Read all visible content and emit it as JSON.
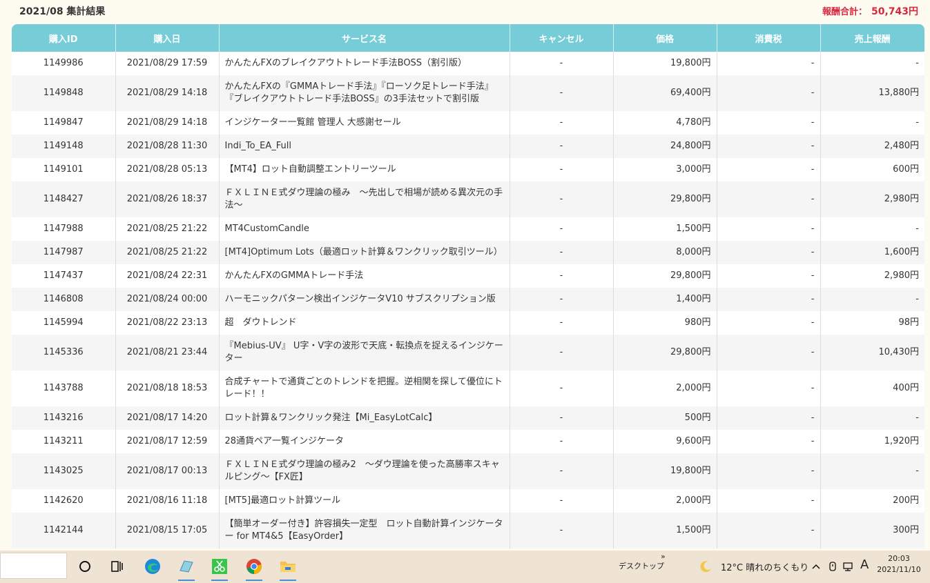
{
  "header": {
    "title": "2021/08 集計結果",
    "total_label": "報酬合計：",
    "total_value": "50,743円"
  },
  "table": {
    "columns": [
      "購入ID",
      "購入日",
      "サービス名",
      "キャンセル",
      "価格",
      "消費税",
      "売上報酬"
    ],
    "rows": [
      {
        "id": "1149986",
        "date": "2021/08/29 17:59",
        "service": "かんたんFXのブレイクアウトトレード手法BOSS（割引版）",
        "cancel": "-",
        "price": "19,800円",
        "tax": "-",
        "reward": "-"
      },
      {
        "id": "1149848",
        "date": "2021/08/29 14:18",
        "service": "かんたんFXの『GMMAトレード手法』『ローソク足トレード手法』『ブレイクアウトトレード手法BOSS』の3手法セットで割引版",
        "cancel": "-",
        "price": "69,400円",
        "tax": "-",
        "reward": "13,880円"
      },
      {
        "id": "1149847",
        "date": "2021/08/29 14:18",
        "service": "インジケーター一覧館 管理人 大感謝セール",
        "cancel": "-",
        "price": "4,780円",
        "tax": "-",
        "reward": "-"
      },
      {
        "id": "1149148",
        "date": "2021/08/28 11:30",
        "service": "Indi_To_EA_Full",
        "cancel": "-",
        "price": "24,800円",
        "tax": "-",
        "reward": "2,480円"
      },
      {
        "id": "1149101",
        "date": "2021/08/28 05:13",
        "service": "【MT4】ロット自動調整エントリーツール",
        "cancel": "-",
        "price": "3,000円",
        "tax": "-",
        "reward": "600円"
      },
      {
        "id": "1148427",
        "date": "2021/08/26 18:37",
        "service": "ＦＸＬＩＮＥ式ダウ理論の極み　～先出しで相場が読める異次元の手法～",
        "cancel": "-",
        "price": "29,800円",
        "tax": "-",
        "reward": "2,980円"
      },
      {
        "id": "1147988",
        "date": "2021/08/25 21:22",
        "service": "MT4CustomCandle",
        "cancel": "-",
        "price": "1,500円",
        "tax": "-",
        "reward": "-"
      },
      {
        "id": "1147987",
        "date": "2021/08/25 21:22",
        "service": "[MT4]Optimum Lots（最適ロット計算＆ワンクリック取引ツール）",
        "cancel": "-",
        "price": "8,000円",
        "tax": "-",
        "reward": "1,600円"
      },
      {
        "id": "1147437",
        "date": "2021/08/24 22:31",
        "service": "かんたんFXのGMMAトレード手法",
        "cancel": "-",
        "price": "29,800円",
        "tax": "-",
        "reward": "2,980円"
      },
      {
        "id": "1146808",
        "date": "2021/08/24 00:00",
        "service": "ハーモニックパターン検出インジケータV10 サブスクリプション版",
        "cancel": "-",
        "price": "1,400円",
        "tax": "-",
        "reward": "-"
      },
      {
        "id": "1145994",
        "date": "2021/08/22 23:13",
        "service": "超　ダウトレンド",
        "cancel": "-",
        "price": "980円",
        "tax": "-",
        "reward": "98円"
      },
      {
        "id": "1145336",
        "date": "2021/08/21 23:44",
        "service": "『Mebius-UV』 U字・V字の波形で天底・転換点を捉えるインジケーター",
        "cancel": "-",
        "price": "29,800円",
        "tax": "-",
        "reward": "10,430円"
      },
      {
        "id": "1143788",
        "date": "2021/08/18 18:53",
        "service": "合成チャートで通貨ごとのトレンドを把握。逆相関を探して優位にトレード！！",
        "cancel": "-",
        "price": "2,000円",
        "tax": "-",
        "reward": "400円"
      },
      {
        "id": "1143216",
        "date": "2021/08/17 14:20",
        "service": "ロット計算＆ワンクリック発注【Mi_EasyLotCalc】",
        "cancel": "-",
        "price": "500円",
        "tax": "-",
        "reward": "-"
      },
      {
        "id": "1143211",
        "date": "2021/08/17 12:59",
        "service": "28通貨ペア一覧インジケータ",
        "cancel": "-",
        "price": "9,600円",
        "tax": "-",
        "reward": "1,920円"
      },
      {
        "id": "1143025",
        "date": "2021/08/17 00:13",
        "service": "ＦＸＬＩＮＥ式ダウ理論の極み2　～ダウ理論を使った高勝率スキャルピング～【FX匠】",
        "cancel": "-",
        "price": "19,800円",
        "tax": "-",
        "reward": "-"
      },
      {
        "id": "1142620",
        "date": "2021/08/16 11:18",
        "service": "[MT5]最適ロット計算ツール",
        "cancel": "-",
        "price": "2,000円",
        "tax": "-",
        "reward": "200円"
      },
      {
        "id": "1142144",
        "date": "2021/08/15 17:05",
        "service": "【簡単オーダー付き】許容損失一定型　ロット自動計算インジケーター for MT4&5【EasyOrder】",
        "cancel": "-",
        "price": "1,500円",
        "tax": "-",
        "reward": "300円"
      }
    ]
  },
  "taskbar": {
    "desktop_label": "デスクトップ",
    "chevron": "»",
    "weather": "12°C  晴れのちくもり",
    "ime": "A",
    "time": "20:03",
    "date": "2021/11/10",
    "icons": [
      "cortana-icon",
      "task-view-icon",
      "edge-icon",
      "app-icon",
      "snipping-tool-icon",
      "chrome-icon",
      "file-explorer-icon"
    ]
  }
}
